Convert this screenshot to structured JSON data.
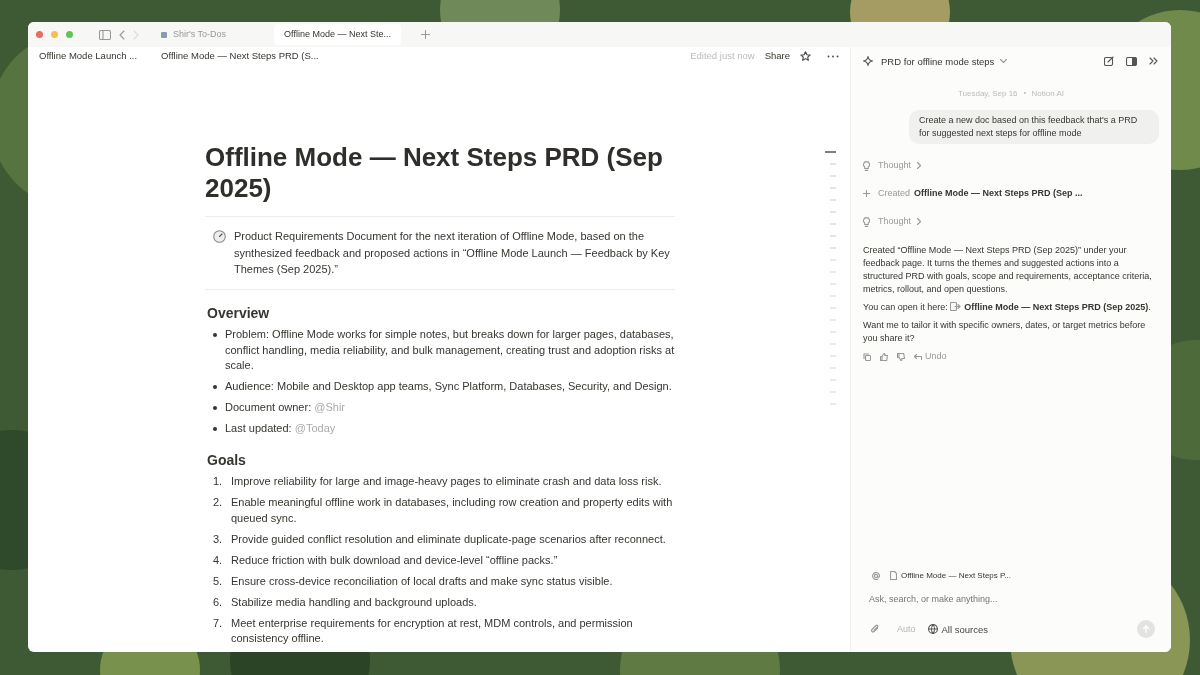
{
  "window": {
    "tabs": [
      {
        "label": "Shir's To-Dos",
        "selected": false
      },
      {
        "label": "Offline Mode — Next Ste...",
        "selected": true
      }
    ]
  },
  "toolbar": {
    "breadcrumbs": [
      "Offline Mode Launch ...",
      "Offline Mode — Next Steps PRD (S..."
    ],
    "edited": "Edited just now",
    "share": "Share"
  },
  "doc": {
    "title": "Offline Mode — Next Steps PRD (Sep 2025)",
    "callout": "Product Requirements Document for the next iteration of Offline Mode, based on the synthesized feedback and proposed actions in “Offline Mode Launch — Feedback by Key Themes (Sep 2025).”",
    "sections": [
      {
        "heading": "Overview",
        "items": [
          {
            "text": "Problem: Offline Mode works for simple notes, but breaks down for larger pages, databases, conflict handling, media reliability, and bulk management, creating trust and adoption risks at scale."
          },
          {
            "text": "Audience: Mobile and Desktop app teams, Sync Platform, Databases, Security, and Design."
          },
          {
            "text": "Document owner: ",
            "mention": "@Shir"
          },
          {
            "text": "Last updated: ",
            "mention": "@Today"
          }
        ]
      },
      {
        "heading": "Goals",
        "items": [
          {
            "number": "1.",
            "text": "Improve reliability for large and image-heavy pages to eliminate crash and data loss risk."
          },
          {
            "number": "2.",
            "text": "Enable meaningful offline work in databases, including row creation and property edits with queued sync."
          },
          {
            "number": "3.",
            "text": "Provide guided conflict resolution and eliminate duplicate-page scenarios after reconnect."
          },
          {
            "number": "4.",
            "text": "Reduce friction with bulk download and device-level “offline packs.”"
          },
          {
            "number": "5.",
            "text": "Ensure cross-device reconciliation of local drafts and make sync status visible."
          },
          {
            "number": "6.",
            "text": "Stabilize media handling and background uploads."
          },
          {
            "number": "7.",
            "text": "Meet enterprise requirements for encryption at rest, MDM controls, and permission consistency offline."
          }
        ]
      }
    ]
  },
  "chat": {
    "title": "PRD for offline mode steps",
    "date": "Tuesday, Sep 16",
    "author": "Notion AI",
    "messages": [
      {
        "kind": "user",
        "text": "Create a new doc based on this feedback that's a PRD for suggested next steps for offline mode"
      },
      {
        "kind": "thought",
        "text": "Thought"
      },
      {
        "kind": "created",
        "label": "Created",
        "title": "Offline Mode — Next Steps PRD (Sep ..."
      },
      {
        "kind": "thought",
        "text": "Thought"
      },
      {
        "kind": "reply",
        "paragraphs": [
          {
            "text": "Created “Offline Mode — Next Steps PRD (Sep 2025)” under your feedback page. It turns the themes and suggested actions into a structured PRD with goals, scope and requirements, acceptance criteria, metrics, rollout, and open questions."
          },
          {
            "text": "You can open it here: ",
            "link": "Offline Mode — Next Steps PRD (Sep 2025)",
            "after": "."
          },
          {
            "text": "Want me to tailor it with specific owners, dates, or target metrics before you share it?"
          }
        ],
        "undo": "Undo"
      }
    ],
    "composer": {
      "context": "Offline Mode — Next Steps P...",
      "placeholder": "Ask, search, or make anything...",
      "mode": "Auto",
      "sources": "All sources",
      "send_disabled": true
    }
  }
}
